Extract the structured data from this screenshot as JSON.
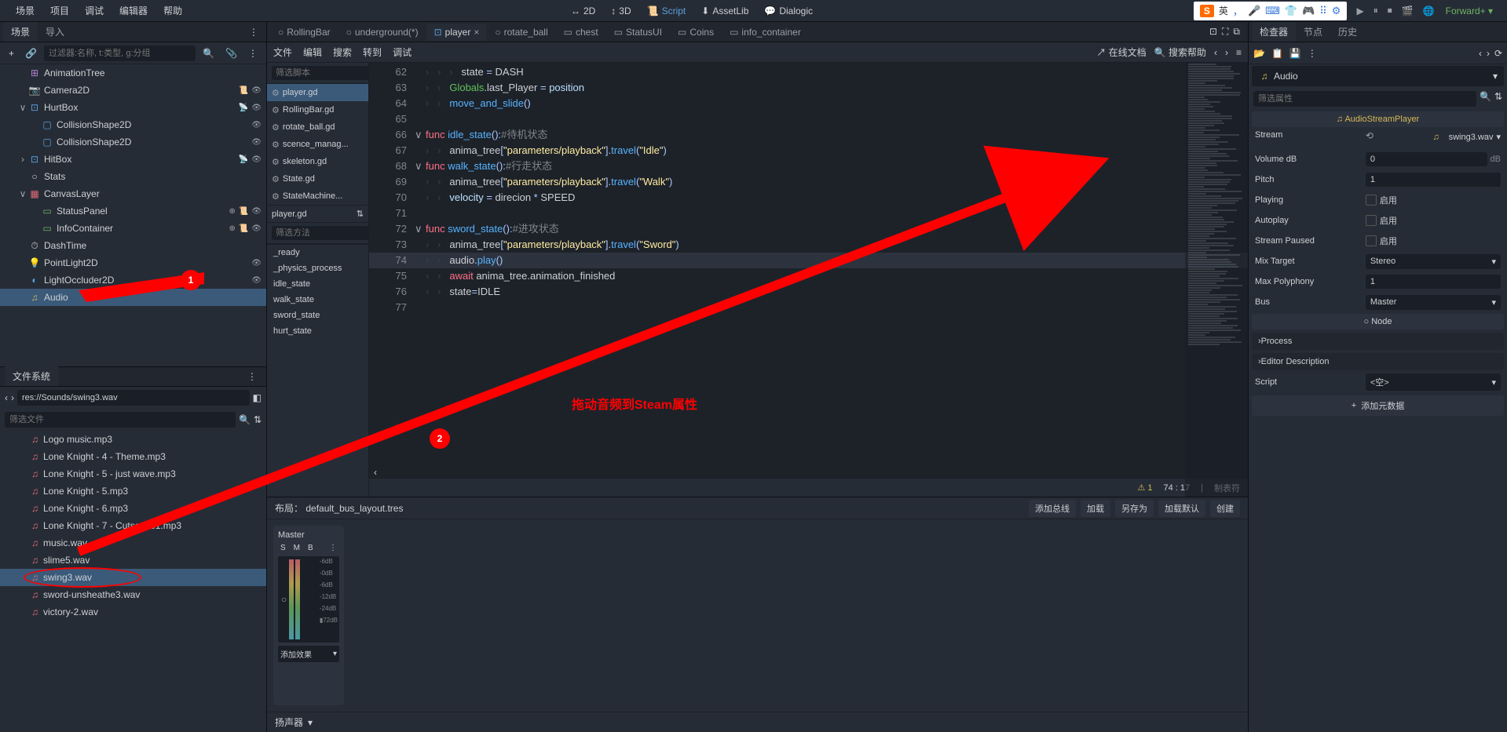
{
  "menubar": {
    "items": [
      "场景",
      "项目",
      "调试",
      "编辑器",
      "帮助"
    ],
    "center": [
      {
        "label": "2D",
        "icon": "↔"
      },
      {
        "label": "3D",
        "icon": "↕"
      },
      {
        "label": "Script",
        "icon": "📜",
        "active": true
      },
      {
        "label": "AssetLib",
        "icon": "⬇"
      },
      {
        "label": "Dialogic",
        "icon": "💬"
      }
    ],
    "ime": {
      "s": "S",
      "lang": "英",
      "icons": [
        "，",
        "🎤",
        "⌨",
        "👕",
        "🎮",
        "⠿",
        "⚙"
      ]
    },
    "right_icons": [
      "▶",
      "⏸",
      "⏹",
      "🎬",
      "🌐"
    ],
    "forward": "Forward+"
  },
  "scene_panel": {
    "tabs": [
      "场景",
      "导入"
    ],
    "filter_placeholder": "过滤器:名称, t:类型, g:分组",
    "nodes": [
      {
        "name": "AnimationTree",
        "icon": "⊞",
        "color": "purple",
        "indent": 1,
        "suffix": []
      },
      {
        "name": "Camera2D",
        "icon": "📷",
        "color": "blue",
        "indent": 1,
        "suffix": [
          "📜",
          "👁"
        ]
      },
      {
        "name": "HurtBox",
        "icon": "⊡",
        "color": "blue",
        "indent": 1,
        "toggle": "∨",
        "suffix": [
          "📡",
          "👁"
        ]
      },
      {
        "name": "CollisionShape2D",
        "icon": "▢",
        "color": "blue",
        "indent": 2,
        "suffix": [
          "👁"
        ]
      },
      {
        "name": "CollisionShape2D",
        "icon": "▢",
        "color": "blue",
        "indent": 2,
        "suffix": [
          "👁"
        ]
      },
      {
        "name": "HitBox",
        "icon": "⊡",
        "color": "blue",
        "indent": 1,
        "toggle": "›",
        "suffix": [
          "📡",
          "👁"
        ]
      },
      {
        "name": "Stats",
        "icon": "○",
        "color": "",
        "indent": 1
      },
      {
        "name": "CanvasLayer",
        "icon": "▦",
        "color": "red",
        "indent": 1,
        "toggle": "∨"
      },
      {
        "name": "StatusPanel",
        "icon": "▭",
        "color": "green",
        "indent": 2,
        "suffix": [
          "⊕",
          "📜",
          "👁"
        ]
      },
      {
        "name": "InfoContainer",
        "icon": "▭",
        "color": "green",
        "indent": 2,
        "suffix": [
          "⊕",
          "📜",
          "👁"
        ]
      },
      {
        "name": "DashTime",
        "icon": "⏱",
        "color": "",
        "indent": 1
      },
      {
        "name": "PointLight2D",
        "icon": "💡",
        "color": "blue",
        "indent": 1,
        "suffix": [
          "👁"
        ]
      },
      {
        "name": "LightOccluder2D",
        "icon": "◐",
        "color": "blue",
        "indent": 1,
        "suffix": [
          "👁"
        ]
      },
      {
        "name": "Audio",
        "icon": "♫",
        "color": "yellow",
        "indent": 1,
        "selected": true
      }
    ]
  },
  "fs_panel": {
    "title": "文件系统",
    "path": "res://Sounds/swing3.wav",
    "filter_placeholder": "筛选文件",
    "files": [
      {
        "name": "Logo music.mp3"
      },
      {
        "name": "Lone Knight - 4 - Theme.mp3"
      },
      {
        "name": "Lone Knight - 5 - just wave.mp3"
      },
      {
        "name": "Lone Knight - 5.mp3"
      },
      {
        "name": "Lone Knight - 6.mp3"
      },
      {
        "name": "Lone Knight - 7 - Cutscene1.mp3"
      },
      {
        "name": "music.wav"
      },
      {
        "name": "slime5.wav"
      },
      {
        "name": "swing3.wav",
        "selected": true,
        "circled": true
      },
      {
        "name": "sword-unsheathe3.wav"
      },
      {
        "name": "victory-2.wav"
      }
    ]
  },
  "open_tabs": [
    {
      "label": "RollingBar",
      "icon": "○"
    },
    {
      "label": "underground(*)",
      "icon": "○"
    },
    {
      "label": "player",
      "icon": "⊡",
      "active": true,
      "close": true
    },
    {
      "label": "rotate_ball",
      "icon": "○"
    },
    {
      "label": "chest",
      "icon": "▭"
    },
    {
      "label": "StatusUI",
      "icon": "▭"
    },
    {
      "label": "Coins",
      "icon": "▭"
    },
    {
      "label": "info_container",
      "icon": "▭"
    }
  ],
  "script_toolbar": [
    "文件",
    "编辑",
    "搜索",
    "转到",
    "调试"
  ],
  "script_toolbar_right": {
    "online": "在线文档",
    "search": "搜索帮助"
  },
  "script_sidebar": {
    "filter_label": "筛选脚本",
    "scripts": [
      {
        "name": "player.gd",
        "active": true
      },
      {
        "name": "RollingBar.gd"
      },
      {
        "name": "rotate_ball.gd"
      },
      {
        "name": "scence_manag..."
      },
      {
        "name": "skeleton.gd"
      },
      {
        "name": "State.gd"
      },
      {
        "name": "StateMachine..."
      }
    ],
    "current": "player.gd",
    "method_label": "筛选方法",
    "methods": [
      "_ready",
      "_physics_process",
      "idle_state",
      "walk_state",
      "sword_state",
      "hurt_state"
    ]
  },
  "code": [
    {
      "n": 62,
      "indent": 3,
      "html": "state <span class='op'>=</span> DASH"
    },
    {
      "n": 63,
      "indent": 2,
      "html": "<span class='glob'>Globals</span><span class='op'>.</span>last_Player <span class='op'>=</span> <span class='member'>position</span>"
    },
    {
      "n": 64,
      "indent": 2,
      "html": "<span class='fn'>move_and_slide</span><span class='op'>()</span>"
    },
    {
      "n": 65,
      "indent": 0,
      "html": ""
    },
    {
      "n": 66,
      "indent": 0,
      "fold": "∨",
      "html": "<span class='kw'>func</span> <span class='fn'>idle_state</span><span class='op'>():</span><span class='com'>#待机状态</span>"
    },
    {
      "n": 67,
      "indent": 2,
      "html": "anima_tree<span class='op'>[</span><span class='str'>\"parameters/playback\"</span><span class='op'>].</span><span class='fn'>travel</span><span class='op'>(</span><span class='str'>\"Idle\"</span><span class='op'>)</span>"
    },
    {
      "n": 68,
      "indent": 0,
      "fold": "∨",
      "html": "<span class='kw'>func</span> <span class='fn'>walk_state</span><span class='op'>():</span><span class='com'>#行走状态</span>"
    },
    {
      "n": 69,
      "indent": 2,
      "html": "anima_tree<span class='op'>[</span><span class='str'>\"parameters/playback\"</span><span class='op'>].</span><span class='fn'>travel</span><span class='op'>(</span><span class='str'>\"Walk\"</span><span class='op'>)</span>"
    },
    {
      "n": 70,
      "indent": 2,
      "html": "<span class='member'>velocity</span> <span class='op'>=</span> direcion <span class='op'>*</span> SPEED"
    },
    {
      "n": 71,
      "indent": 0,
      "html": ""
    },
    {
      "n": 72,
      "indent": 0,
      "fold": "∨",
      "html": "<span class='kw'>func</span> <span class='fn'>sword_state</span><span class='op'>():</span><span class='com'>#进攻状态</span>"
    },
    {
      "n": 73,
      "indent": 2,
      "html": "anima_tree<span class='op'>[</span><span class='str'>\"parameters/playback\"</span><span class='op'>].</span><span class='fn'>travel</span><span class='op'>(</span><span class='str'>\"Sword\"</span><span class='op'>)</span>"
    },
    {
      "n": 74,
      "indent": 2,
      "hl": true,
      "html": "audio<span class='op'>.</span><span class='fn'>play</span><span class='op'>()</span>"
    },
    {
      "n": 75,
      "indent": 2,
      "html": "<span class='kw'>await</span> anima_tree<span class='op'>.</span>animation_finished"
    },
    {
      "n": 76,
      "indent": 2,
      "html": "state<span class='op'>=</span>IDLE"
    },
    {
      "n": 77,
      "indent": 0,
      "html": ""
    }
  ],
  "code_status": {
    "warn_count": "1",
    "pos": "74 :   17",
    "mode": "制表符"
  },
  "bus": {
    "layout_label": "布局：",
    "layout": "default_bus_layout.tres",
    "buttons": [
      "添加总线",
      "加载",
      "另存为",
      "加载默认",
      "创建"
    ],
    "master": "Master",
    "smb": [
      "S",
      "M",
      "B"
    ],
    "db_labels": [
      "-6dB",
      "-0dB",
      "-6dB",
      "-12dB",
      "-24dB",
      "▮72dB"
    ],
    "add_effect": "添加效果",
    "footer": "扬声器"
  },
  "inspector": {
    "tabs": [
      "检查器",
      "节点",
      "历史"
    ],
    "breadcrumb": "Audio",
    "filter_placeholder": "筛选属性",
    "class_name": "AudioStreamPlayer",
    "stream_label": "Stream",
    "stream_file": "swing3.wav",
    "props": [
      {
        "label": "Volume dB",
        "value": "0",
        "unit": "dB",
        "type": "num"
      },
      {
        "label": "Pitch",
        "value": "1",
        "type": "num"
      },
      {
        "label": "Playing",
        "value": "启用",
        "type": "check"
      },
      {
        "label": "Autoplay",
        "value": "启用",
        "type": "check"
      },
      {
        "label": "Stream Paused",
        "value": "启用",
        "type": "check"
      },
      {
        "label": "Mix Target",
        "value": "Stereo",
        "type": "select"
      },
      {
        "label": "Max Polyphony",
        "value": "1",
        "type": "num"
      },
      {
        "label": "Bus",
        "value": "Master",
        "type": "select"
      }
    ],
    "node_section": "Node",
    "collapses": [
      "Process",
      "Editor Description"
    ],
    "script_label": "Script",
    "script_value": "<空>",
    "add_meta": "添加元数据"
  },
  "annotations": {
    "text": "拖动音频到Steam属性"
  }
}
